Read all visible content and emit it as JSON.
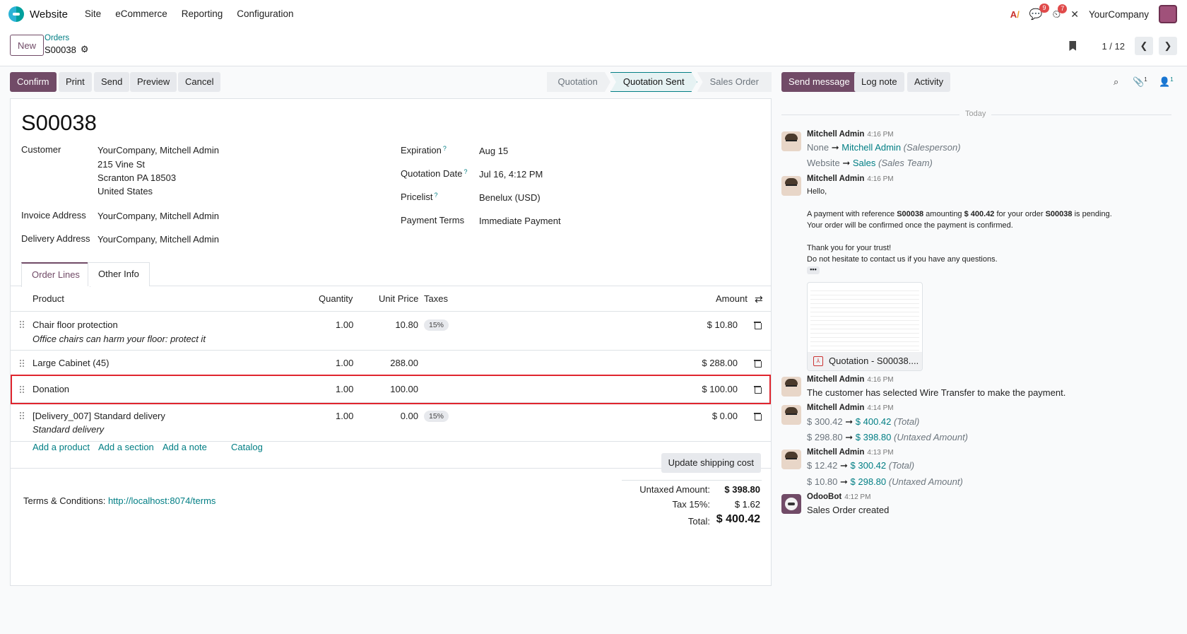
{
  "topnav": {
    "app": "Website",
    "menu": [
      "Site",
      "eCommerce",
      "Reporting",
      "Configuration"
    ],
    "messages_badge": "9",
    "activity_badge": "7",
    "company": "YourCompany"
  },
  "control_panel": {
    "new_label": "New",
    "breadcrumb_parent": "Orders",
    "breadcrumb_current": "S00038",
    "pager": "1 / 12"
  },
  "actions": {
    "confirm": "Confirm",
    "print": "Print",
    "send": "Send",
    "preview": "Preview",
    "cancel": "Cancel"
  },
  "stages": [
    "Quotation",
    "Quotation Sent",
    "Sales Order"
  ],
  "active_stage": "Quotation Sent",
  "form": {
    "title": "S00038",
    "customer_label": "Customer",
    "customer": "YourCompany, Mitchell Admin",
    "address": [
      "215 Vine St",
      "Scranton PA 18503",
      "United States"
    ],
    "invoice_label": "Invoice Address",
    "invoice": "YourCompany, Mitchell Admin",
    "delivery_label": "Delivery Address",
    "delivery": "YourCompany, Mitchell Admin",
    "expiration_label": "Expiration",
    "expiration": "Aug 15",
    "qdate_label": "Quotation Date",
    "qdate": "Jul 16, 4:12 PM",
    "pricelist_label": "Pricelist",
    "pricelist": "Benelux (USD)",
    "terms_label": "Payment Terms",
    "terms": "Immediate Payment"
  },
  "tabs": [
    "Order Lines",
    "Other Info"
  ],
  "table": {
    "headers": [
      "Product",
      "Quantity",
      "Unit Price",
      "Taxes",
      "Amount"
    ],
    "rows": [
      {
        "product": "Chair floor protection",
        "desc": "Office chairs can harm your floor: protect it",
        "qty": "1.00",
        "price": "10.80",
        "tax": "15%",
        "amount": "$ 10.80"
      },
      {
        "product": "Large Cabinet (45)",
        "desc": "",
        "qty": "1.00",
        "price": "288.00",
        "tax": "",
        "amount": "$ 288.00"
      },
      {
        "product": "Donation",
        "desc": "",
        "qty": "1.00",
        "price": "100.00",
        "tax": "",
        "amount": "$ 100.00"
      },
      {
        "product": "[Delivery_007] Standard delivery",
        "desc": "Standard delivery",
        "qty": "1.00",
        "price": "0.00",
        "tax": "15%",
        "amount": "$ 0.00"
      }
    ],
    "add_product": "Add a product",
    "add_section": "Add a section",
    "add_note": "Add a note",
    "catalog": "Catalog"
  },
  "footer": {
    "update_shipping": "Update shipping cost",
    "terms_label": "Terms & Conditions:",
    "terms_link": "http://localhost:8074/terms",
    "untaxed_label": "Untaxed Amount:",
    "untaxed": "$ 398.80",
    "tax_label": "Tax 15%:",
    "tax": "$ 1.62",
    "total_label": "Total:",
    "total": "$ 400.42"
  },
  "chatter": {
    "send_message": "Send message",
    "log_note": "Log note",
    "activity": "Activity",
    "attachments_count": "1",
    "followers_count": "1",
    "today": "Today",
    "messages": [
      {
        "author": "Mitchell Admin",
        "time": "4:16 PM"
      },
      {
        "author": "Mitchell Admin",
        "time": "4:16 PM"
      },
      {
        "author": "Mitchell Admin",
        "time": "4:16 PM"
      },
      {
        "author": "Mitchell Admin",
        "time": "4:14 PM"
      },
      {
        "author": "Mitchell Admin",
        "time": "4:13 PM"
      },
      {
        "author": "OdooBot",
        "time": "4:12 PM"
      }
    ],
    "m1": {
      "from1": "None",
      "to1": "Mitchell Admin",
      "f1": "(Salesperson)",
      "from2": "Website",
      "to2": "Sales",
      "f2": "(Sales Team)"
    },
    "m2": {
      "hello": "Hello,",
      "p1a": "A payment with reference ",
      "ref": "S00038",
      "p1b": " amounting ",
      "amt": "$ 400.42",
      "p1c": " for your order ",
      "ord": "S00038",
      "p1d": " is pending.",
      "p2": "Your order will be confirmed once the payment is confirmed.",
      "p3": "Thank you for your trust!",
      "p4": "Do not hesitate to contact us if you have any questions.",
      "attachment": "Quotation - S00038...."
    },
    "m3": "The customer has selected Wire Transfer to make the payment.",
    "m4": {
      "a1": "$ 300.42",
      "b1": "$ 400.42",
      "f1": "(Total)",
      "a2": "$ 298.80",
      "b2": "$ 398.80",
      "f2": "(Untaxed Amount)"
    },
    "m5": {
      "a1": "$ 12.42",
      "b1": "$ 300.42",
      "f1": "(Total)",
      "a2": "$ 10.80",
      "b2": "$ 298.80",
      "f2": "(Untaxed Amount)"
    },
    "m6": "Sales Order created"
  }
}
